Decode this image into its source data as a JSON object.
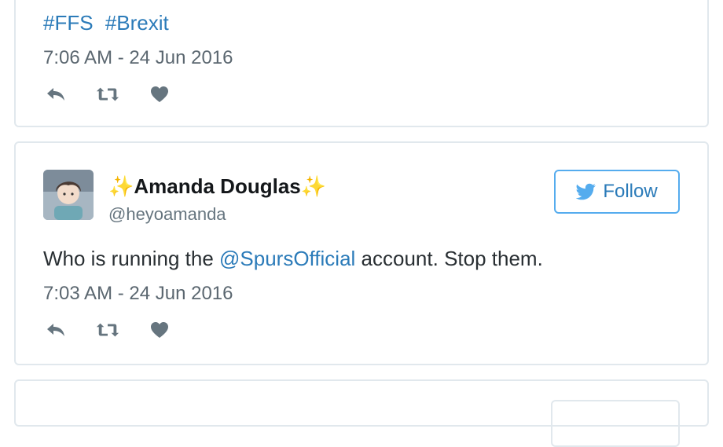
{
  "top_tweet": {
    "hashtags": [
      "#FFS",
      "#Brexit"
    ],
    "timestamp": "7:06 AM - 24 Jun 2016"
  },
  "main_tweet": {
    "name": "✨Amanda Douglas✨",
    "handle": "@heyoamanda",
    "follow_label": "Follow",
    "text_before": "Who is running the ",
    "mention": "@SpursOfficial",
    "text_after": " account. Stop them.",
    "timestamp": "7:03 AM - 24 Jun 2016"
  },
  "colors": {
    "link": "#2b7bb9",
    "icon": "#66757f",
    "border": "#e1e8ed",
    "follow_border": "#55acee"
  }
}
